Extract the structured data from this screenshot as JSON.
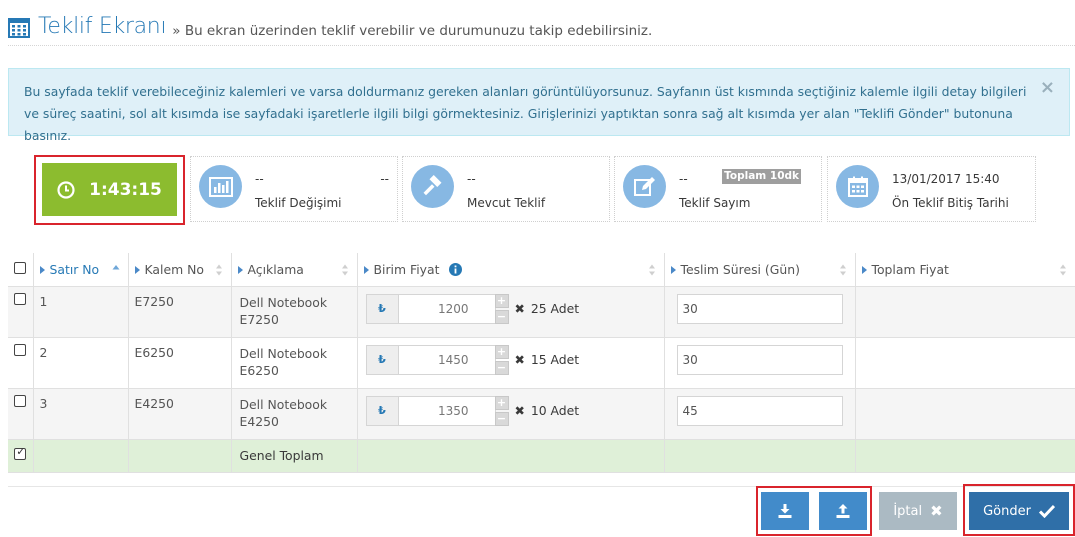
{
  "header": {
    "title": "Teklif Ekranı",
    "subtitle": "» Bu ekran üzerinden teklif verebilir ve durumunuzu takip edebilirsiniz."
  },
  "alert": {
    "text": "Bu sayfada teklif verebileceğiniz kalemleri ve varsa doldurmanız gereken alanları görüntülüyorsunuz. Sayfanın üst kısmında seçtiğiniz kalemle ilgili detay bilgileri ve süreç saatini, sol alt kısımda ise sayfadaki işaretlerle ilgili bilgi görmektesiniz. Girişlerinizi yaptıktan sonra sağ alt kısımda yer alan \"Teklifi Gönder\" butonuna basınız.",
    "close": "×"
  },
  "timer": {
    "value": "1:43:15"
  },
  "cards": {
    "change": {
      "value": "--",
      "value2": "--",
      "label": "Teklif Değişimi"
    },
    "current": {
      "value": "--",
      "label": "Mevcut Teklif"
    },
    "count": {
      "value": "--",
      "badge": "Toplam 10dk",
      "label": "Teklif Sayım"
    },
    "deadline": {
      "value": "13/01/2017 15:40",
      "label": "Ön Teklif Bitiş Tarihi"
    }
  },
  "table": {
    "headers": {
      "row_no": "Satır No",
      "item_no": "Kalem No",
      "desc": "Açıklama",
      "unit_price": "Birim Fiyat",
      "delivery": "Teslim Süresi (Gün)",
      "total": "Toplam Fiyat"
    },
    "rows": [
      {
        "no": "1",
        "item": "E7250",
        "desc1": "Dell Notebook",
        "desc2": "E7250",
        "price": "1200",
        "qty": "25 Adet",
        "days": "30"
      },
      {
        "no": "2",
        "item": "E6250",
        "desc1": "Dell Notebook",
        "desc2": "E6250",
        "price": "1450",
        "qty": "15 Adet",
        "days": "30"
      },
      {
        "no": "3",
        "item": "E4250",
        "desc1": "Dell Notebook",
        "desc2": "E4250",
        "price": "1350",
        "qty": "10 Adet",
        "days": "45"
      }
    ],
    "currency": "₺",
    "times": "✖",
    "grand_total": "Genel Toplam"
  },
  "buttons": {
    "cancel": "İptal",
    "send": "Gönder"
  },
  "colors": {
    "accent": "#2679b5",
    "timer": "#8cbc2f",
    "highlight": "#d9242c",
    "total_row": "#dff0d8"
  }
}
